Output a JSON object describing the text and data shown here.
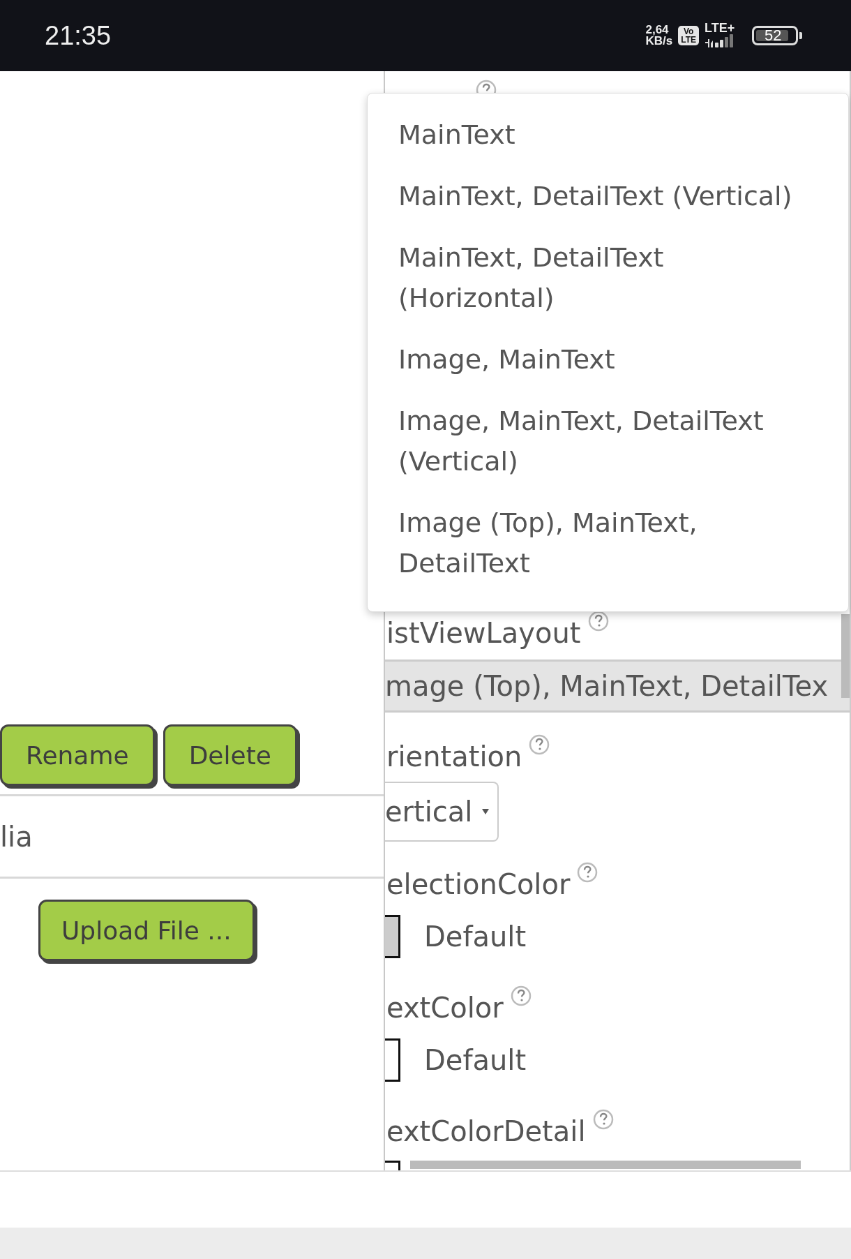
{
  "status_bar": {
    "time": "21:35",
    "net_speed": [
      "2,64",
      "KB/s"
    ],
    "volte": [
      "Vo",
      "LTE"
    ],
    "network": "LTE+",
    "battery": "52"
  },
  "assets": {
    "buttons": [
      {
        "label": "Rename"
      },
      {
        "label": "Delete"
      }
    ],
    "item": "lia",
    "upload_button": "Upload File ..."
  },
  "properties": {
    "list_view_layout": {
      "label": "istViewLayout",
      "value": "mage (Top), MainText, DetailTex"
    },
    "orientation": {
      "label": "rientation",
      "value": "ertical"
    },
    "colors": [
      {
        "label": "electionColor",
        "value": "Default",
        "color": "#cccccc"
      },
      {
        "label": "extColor",
        "value": "Default",
        "color": "#ffffff"
      },
      {
        "label": "extColorDetail",
        "color": "#ffffff"
      }
    ]
  },
  "dropdown": {
    "options": [
      {
        "label": "MainText",
        "selected": false
      },
      {
        "label": "MainText, DetailText (Vertical)",
        "selected": false
      },
      {
        "label": "MainText, DetailText (Horizontal)",
        "selected": false
      },
      {
        "label": "Image, MainText",
        "selected": false
      },
      {
        "label": "Image, MainText, DetailText (Vertical)",
        "selected": false
      },
      {
        "label": "Image (Top), MainText, DetailText",
        "selected": false
      }
    ]
  }
}
